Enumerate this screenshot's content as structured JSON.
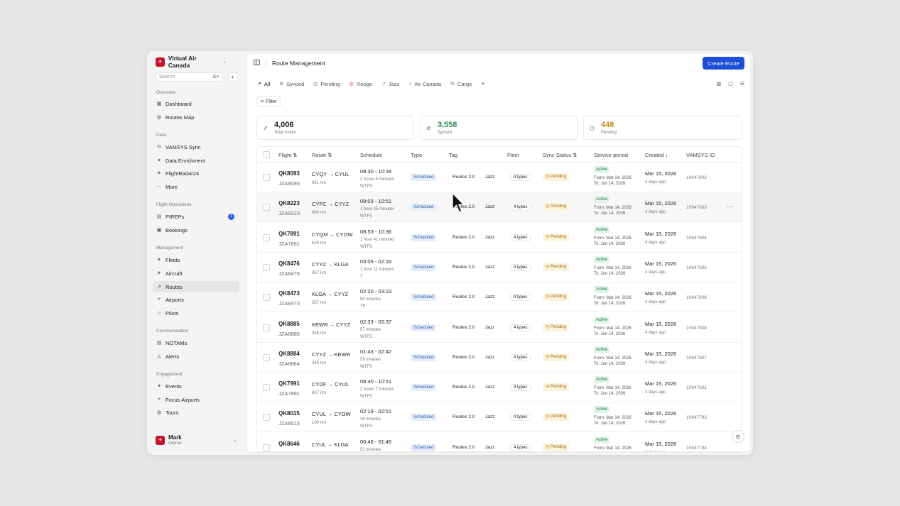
{
  "workspace": {
    "name": "Virtual Air Canada",
    "logo": "✈"
  },
  "search": {
    "placeholder": "Search",
    "shortcut": "⌘K"
  },
  "sidebar": {
    "overview": {
      "heading": "Overview",
      "items": [
        {
          "label": "Dashboard",
          "icon": "dashboard-icon"
        },
        {
          "label": "Routes Map",
          "icon": "globe-icon"
        }
      ]
    },
    "data": {
      "heading": "Data",
      "items": [
        {
          "label": "VAMSYS Sync"
        },
        {
          "label": "Data Enrichment"
        },
        {
          "label": "FlightRadar24"
        },
        {
          "label": "More"
        }
      ]
    },
    "flight_ops": {
      "heading": "Flight Operations",
      "items": [
        {
          "label": "PIREPs",
          "badge": "1"
        },
        {
          "label": "Bookings"
        }
      ]
    },
    "management": {
      "heading": "Management",
      "items": [
        {
          "label": "Fleets"
        },
        {
          "label": "Aircraft"
        },
        {
          "label": "Routes"
        },
        {
          "label": "Airports"
        },
        {
          "label": "Pilots"
        }
      ]
    },
    "communication": {
      "heading": "Communication",
      "items": [
        {
          "label": "NOTAMs"
        },
        {
          "label": "Alerts"
        }
      ]
    },
    "engagement": {
      "heading": "Engagement",
      "items": [
        {
          "label": "Events"
        },
        {
          "label": "Focus Airports"
        },
        {
          "label": "Tours"
        }
      ]
    }
  },
  "user": {
    "name": "Mark",
    "role": "Owner",
    "initial": "✈"
  },
  "header": {
    "title": "Route Management",
    "create_label": "Create Route"
  },
  "tabs": [
    {
      "label": "All",
      "icon": "⇗"
    },
    {
      "label": "Synced",
      "icon": "⊘"
    },
    {
      "label": "Pending",
      "icon": "◷"
    },
    {
      "label": "Rouge",
      "icon": "◎"
    },
    {
      "label": "Jazz",
      "icon": "↗"
    },
    {
      "label": "Air Canada",
      "icon": "○"
    },
    {
      "label": "Cargo",
      "icon": "⊙"
    }
  ],
  "filter_label": "Filter",
  "stats": [
    {
      "value": "4,006",
      "label": "Total routes",
      "color": "#1a1a1a",
      "icon": "⇗"
    },
    {
      "value": "3,558",
      "label": "Synced",
      "color": "#2e8b57",
      "icon": "⊘"
    },
    {
      "value": "448",
      "label": "Pending",
      "color": "#c98a16",
      "icon": "◷"
    }
  ],
  "columns": {
    "flight": "Flight ⇅",
    "route": "Route ⇅",
    "schedule": "Schedule",
    "type": "Type",
    "tag": "Tag",
    "fleet": "Fleet",
    "sync": "Sync Status ⇅",
    "service": "Service period",
    "created": "Created ↓",
    "vamsys": "VAMSYS ID"
  },
  "rows": [
    {
      "flight": "QK8093",
      "sub": "JZA8093",
      "route": "CYQY → CYUL",
      "dist": "661 nm",
      "time": "08:30 - 10:34",
      "dur": "2 hours 4 minutes",
      "days": "WTFS",
      "type": "Scheduled",
      "tag": "Routes 2.0",
      "tag2": "Jazz",
      "fleet": "4 types",
      "sync": "Pending",
      "status": "Active",
      "from": "From: Mar 14, 2026",
      "to": "To: Jun 14, 2026",
      "created": "Mar 15, 2026",
      "ago": "4 days ago",
      "vid": "10947802"
    },
    {
      "flight": "QK8223",
      "sub": "JZA8223",
      "route": "CYFC → CYYZ",
      "dist": "660 nm",
      "time": "09:03 - 10:51",
      "dur": "1 hour 45 minutes",
      "days": "WTFS",
      "type": "Scheduled",
      "tag": "Routes 2.0",
      "tag2": "Jazz",
      "fleet": "4 types",
      "sync": "Pending",
      "status": "Active",
      "from": "From: Mar 14, 2026",
      "to": "To: Jun 14, 2026",
      "created": "Mar 15, 2026",
      "ago": "4 days ago",
      "vid": "10947803"
    },
    {
      "flight": "QK7891",
      "sub": "JZA7891",
      "route": "CYQM → CYOW",
      "dist": "533 nm",
      "time": "08:53 - 10:36",
      "dur": "1 hour 41 minutes",
      "days": "WTFS",
      "type": "Scheduled",
      "tag": "Routes 2.0",
      "tag2": "Jazz",
      "fleet": "4 types",
      "sync": "Pending",
      "status": "Active",
      "from": "From: Mar 14, 2026",
      "to": "To: Jun 14, 2026",
      "created": "Mar 15, 2026",
      "ago": "4 days ago",
      "vid": "10947804"
    },
    {
      "flight": "QK8476",
      "sub": "JZA8476",
      "route": "CYYZ → KLGA",
      "dist": "357 nm",
      "time": "03:05 - 02:16",
      "dur": "1 hour 11 minutes",
      "days": "T",
      "type": "Scheduled",
      "tag": "Routes 2.0",
      "tag2": "Jazz",
      "fleet": "4 types",
      "sync": "Pending",
      "status": "Active",
      "from": "From: Mar 14, 2026",
      "to": "To: Jun 14, 2026",
      "created": "Mar 15, 2026",
      "ago": "4 days ago",
      "vid": "10947805"
    },
    {
      "flight": "QK8473",
      "sub": "JZA8473",
      "route": "KLGA → CYYZ",
      "dist": "357 nm",
      "time": "02:20 - 03:23",
      "dur": "50 minutes",
      "days": "TF",
      "type": "Scheduled",
      "tag": "Routes 2.0",
      "tag2": "Jazz",
      "fleet": "4 types",
      "sync": "Pending",
      "status": "Active",
      "from": "From: Mar 14, 2026",
      "to": "To: Jun 14, 2026",
      "created": "Mar 15, 2026",
      "ago": "4 days ago",
      "vid": "10947806"
    },
    {
      "flight": "QK8885",
      "sub": "JZA8885",
      "route": "KEWR → CYYZ",
      "dist": "348 nm",
      "time": "02:33 - 03:37",
      "dur": "57 minutes",
      "days": "WTFS",
      "type": "Scheduled",
      "tag": "Routes 2.0",
      "tag2": "Jazz",
      "fleet": "4 types",
      "sync": "Pending",
      "status": "Active",
      "from": "From: Mar 14, 2026",
      "to": "To: Jun 14, 2026",
      "created": "Mar 15, 2026",
      "ago": "4 days ago",
      "vid": "10947808"
    },
    {
      "flight": "QK8884",
      "sub": "JZA8884",
      "route": "CYYZ → KEWR",
      "dist": "348 nm",
      "time": "01:43 - 02:42",
      "dur": "59 minutes",
      "days": "WTFS",
      "type": "Scheduled",
      "tag": "Routes 2.0",
      "tag2": "Jazz",
      "fleet": "4 types",
      "sync": "Pending",
      "status": "Active",
      "from": "From: Mar 14, 2026",
      "to": "To: Jun 14, 2026",
      "created": "Mar 15, 2026",
      "ago": "4 days ago",
      "vid": "10947807"
    },
    {
      "flight": "QK7991",
      "sub": "JZA7991",
      "route": "CYDF → CYUL",
      "dist": "607 nm",
      "time": "08:40 - 10:51",
      "dur": "2 hours 7 minutes",
      "days": "WTFS",
      "type": "Scheduled",
      "tag": "Routes 2.0",
      "tag2": "Jazz",
      "fleet": "4 types",
      "sync": "Pending",
      "status": "Active",
      "from": "From: Mar 14, 2026",
      "to": "To: Jun 14, 2026",
      "created": "Mar 15, 2026",
      "ago": "4 days ago",
      "vid": "10947801"
    },
    {
      "flight": "QK8015",
      "sub": "JZA8015",
      "route": "CYUL → CYOW",
      "dist": "100 nm",
      "time": "02:19 - 02:51",
      "dur": "26 minutes",
      "days": "WTFS",
      "type": "Scheduled",
      "tag": "Routes 2.0",
      "tag2": "Jazz",
      "fleet": "4 types",
      "sync": "Pending",
      "status": "Active",
      "from": "From: Mar 14, 2026",
      "to": "To: Jun 14, 2026",
      "created": "Mar 15, 2026",
      "ago": "4 days ago",
      "vid": "10947793"
    },
    {
      "flight": "QK8646",
      "sub": "JZA8646",
      "route": "CYUL → KLGA",
      "dist": "326 nm",
      "time": "00:46 - 01:46",
      "dur": "52 minutes",
      "days": "WTFS",
      "type": "Scheduled",
      "tag": "Routes 2.0",
      "tag2": "Jazz",
      "fleet": "4 types",
      "sync": "Pending",
      "status": "Active",
      "from": "From: Mar 14, 2026",
      "to": "To: Jun 14, 2026",
      "created": "Mar 15, 2026",
      "ago": "4 days ago",
      "vid": "10947794"
    }
  ],
  "row_menu": "⋯",
  "pending_glyph": "◷"
}
